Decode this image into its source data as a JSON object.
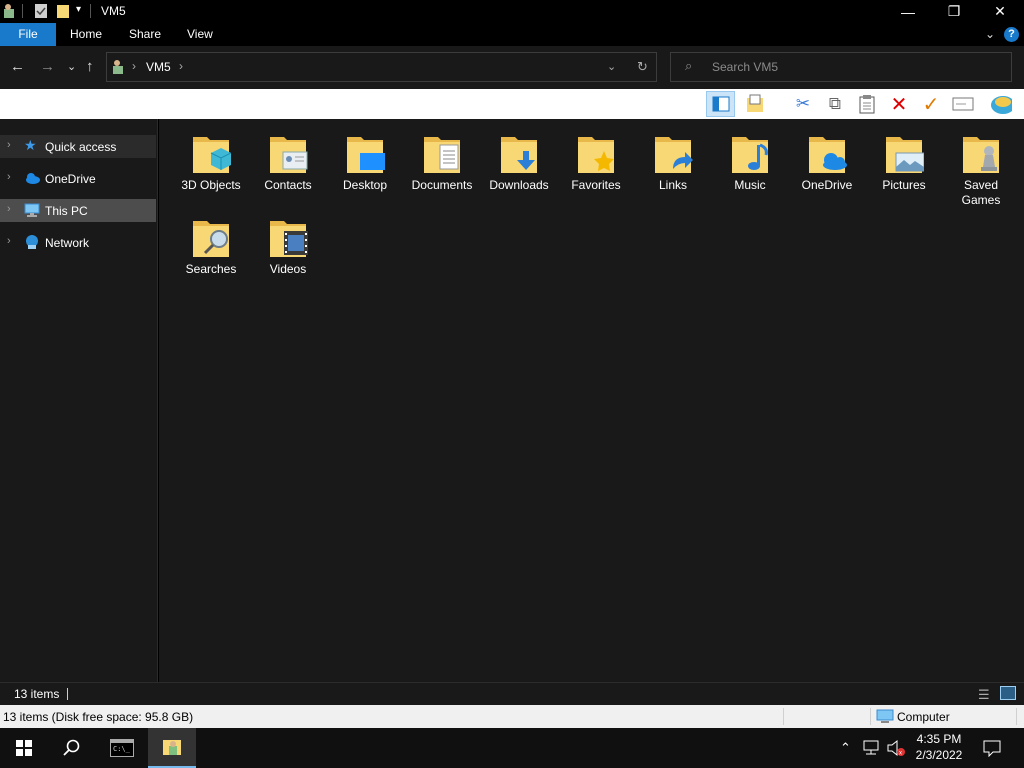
{
  "window": {
    "title": "VM5",
    "controls": {
      "minimize": "—",
      "maximize": "❐",
      "close": "✕"
    }
  },
  "ribbon": {
    "tabs": [
      {
        "label": "File",
        "active": true
      },
      {
        "label": "Home"
      },
      {
        "label": "Share"
      },
      {
        "label": "View"
      }
    ]
  },
  "address": {
    "crumbs": [
      "VM5"
    ],
    "search_placeholder": "Search VM5"
  },
  "toolbar": {
    "icons": [
      "layout-pane-icon",
      "properties-icon",
      "dropdown-arrow-icon",
      "cut-icon",
      "copy-icon",
      "paste-icon",
      "delete-icon",
      "checkmark-icon",
      "rename-icon",
      "shell-icon"
    ]
  },
  "navpane": {
    "items": [
      {
        "label": "Quick access",
        "icon": "star-icon"
      },
      {
        "label": "OneDrive",
        "icon": "cloud-icon"
      },
      {
        "label": "This PC",
        "icon": "computer-icon",
        "selected": true
      },
      {
        "label": "Network",
        "icon": "network-icon"
      }
    ]
  },
  "folders": [
    {
      "label": "3D Objects",
      "icon": "cube-overlay-icon"
    },
    {
      "label": "Contacts",
      "icon": "contact-card-overlay-icon"
    },
    {
      "label": "Desktop",
      "icon": "desktop-overlay-icon"
    },
    {
      "label": "Documents",
      "icon": "document-overlay-icon"
    },
    {
      "label": "Downloads",
      "icon": "download-arrow-overlay-icon"
    },
    {
      "label": "Favorites",
      "icon": "star-overlay-icon"
    },
    {
      "label": "Links",
      "icon": "link-arrow-overlay-icon"
    },
    {
      "label": "Music",
      "icon": "music-note-overlay-icon"
    },
    {
      "label": "OneDrive",
      "icon": "cloud-overlay-icon"
    },
    {
      "label": "Pictures",
      "icon": "picture-overlay-icon"
    },
    {
      "label": "Saved Games",
      "icon": "chess-piece-overlay-icon"
    },
    {
      "label": "Searches",
      "icon": "magnifier-overlay-icon"
    },
    {
      "label": "Videos",
      "icon": "film-overlay-icon"
    }
  ],
  "status": {
    "items_count": "13 items",
    "free_space": "13 items (Disk free space: 95.8 GB)",
    "location": "Computer"
  },
  "taskbar": {
    "time": "4:35 PM",
    "date": "2/3/2022"
  },
  "colors": {
    "accent": "#1979ca",
    "dark_bg": "#191919",
    "folder_yellow": "#f8d775"
  }
}
